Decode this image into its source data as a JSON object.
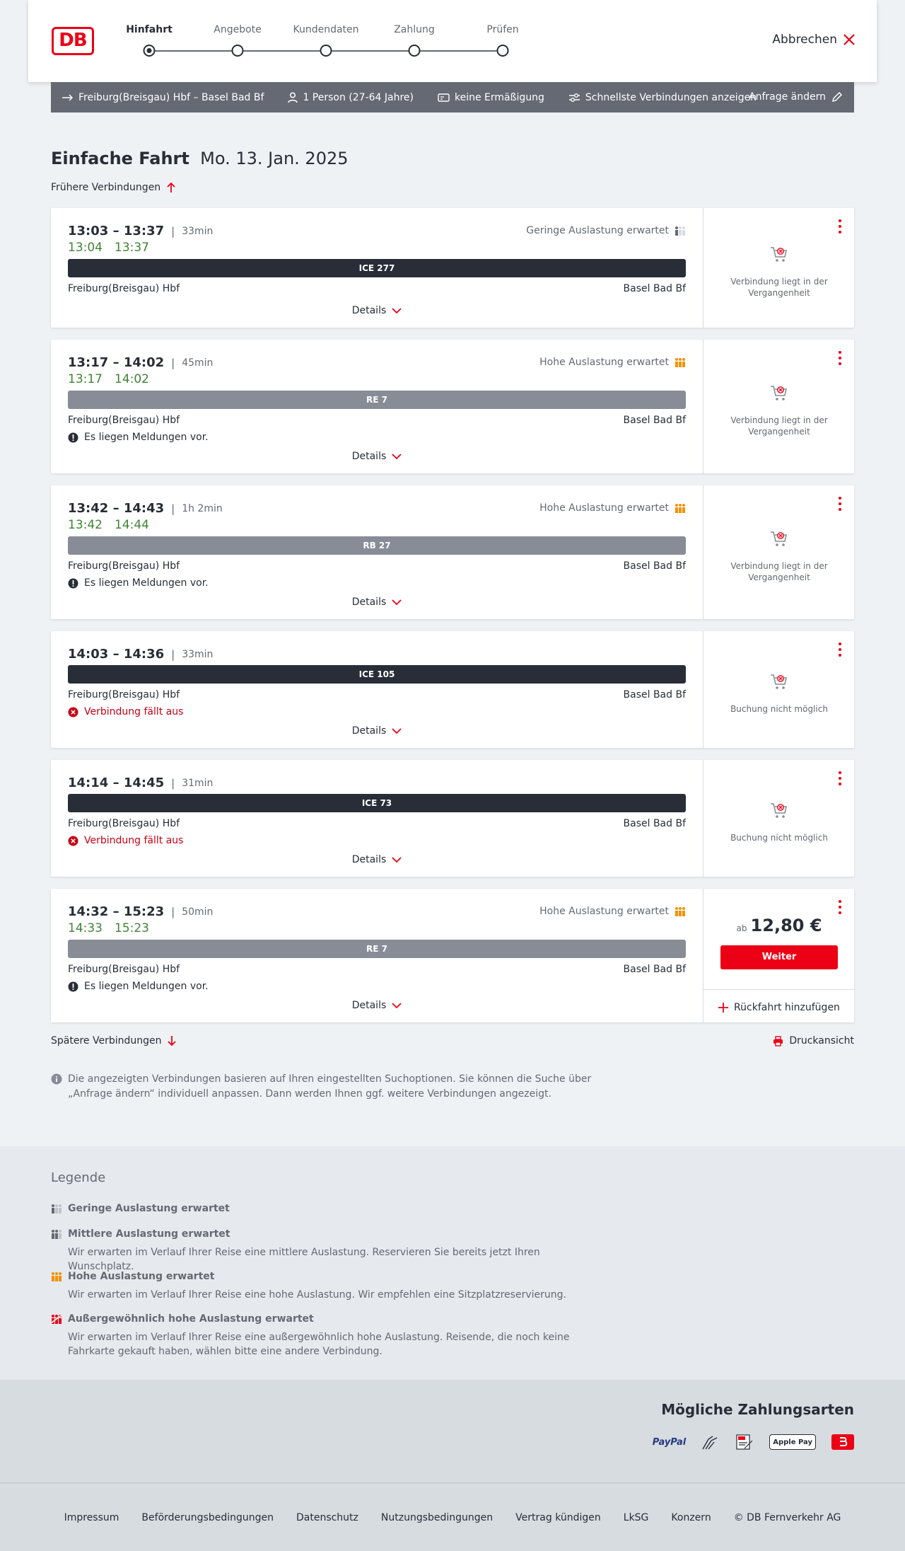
{
  "header": {
    "logo": "DB",
    "steps": [
      "Hinfahrt",
      "Angebote",
      "Kundendaten",
      "Zahlung",
      "Prüfen"
    ],
    "cancel_label": "Abbrechen"
  },
  "query": {
    "route": "Freiburg(Breisgau) Hbf – Basel Bad Bf",
    "persons": "1 Person (27-64 Jahre)",
    "discount": "keine Ermäßigung",
    "fastest": "Schnellste Verbindungen anzeigen",
    "change_label": "Anfrage ändern"
  },
  "title": {
    "trip_type": "Einfache Fahrt",
    "date": "Mo. 13. Jan. 2025"
  },
  "earlier_label": "Frühere Verbindungen",
  "later_label": "Spätere Verbindungen",
  "print_label": "Druckansicht",
  "details_label": "Details",
  "connections": [
    {
      "times": "13:03 – 13:37",
      "duration": "33min",
      "rt_dep": "13:04",
      "rt_arr": "13:37",
      "occupancy": "Geringe Auslastung erwartet",
      "train": "ICE 277",
      "from": "Freiburg(Breisgau) Hbf",
      "to": "Basel Bad Bf",
      "status": "Verbindung liegt in der Vergangenheit"
    },
    {
      "times": "13:17 – 14:02",
      "duration": "45min",
      "rt_dep": "13:17",
      "rt_arr": "14:02",
      "occupancy": "Hohe Auslastung erwartet",
      "train": "RE 7",
      "from": "Freiburg(Breisgau) Hbf",
      "to": "Basel Bad Bf",
      "message": "Es liegen Meldungen vor.",
      "status": "Verbindung liegt in der Vergangenheit"
    },
    {
      "times": "13:42 – 14:43",
      "duration": "1h 2min",
      "rt_dep": "13:42",
      "rt_arr": "14:44",
      "occupancy": "Hohe Auslastung erwartet",
      "train": "RB 27",
      "from": "Freiburg(Breisgau) Hbf",
      "to": "Basel Bad Bf",
      "message": "Es liegen Meldungen vor.",
      "status": "Verbindung liegt in der Vergangenheit"
    },
    {
      "times": "14:03 – 14:36",
      "duration": "33min",
      "train": "ICE 105",
      "from": "Freiburg(Breisgau) Hbf",
      "to": "Basel Bad Bf",
      "message": "Verbindung fällt aus",
      "status": "Buchung nicht möglich"
    },
    {
      "times": "14:14 – 14:45",
      "duration": "31min",
      "train": "ICE 73",
      "from": "Freiburg(Breisgau) Hbf",
      "to": "Basel Bad Bf",
      "message": "Verbindung fällt aus",
      "status": "Buchung nicht möglich"
    },
    {
      "times": "14:32 – 15:23",
      "duration": "50min",
      "rt_dep": "14:33",
      "rt_arr": "15:23",
      "occupancy": "Hohe Auslastung erwartet",
      "train": "RE 7",
      "from": "Freiburg(Breisgau) Hbf",
      "to": "Basel Bad Bf",
      "message": "Es liegen Meldungen vor.",
      "price_prefix": "ab",
      "price": "12,80 €",
      "button": "Weiter",
      "return_label": "Rückfahrt hinzufügen"
    }
  ],
  "info_text": "Die angezeigten Verbindungen basieren auf Ihren eingestellten Suchoptionen. Sie können die Suche über „Anfrage ändern“ individuell anpassen. Dann werden Ihnen ggf. weitere Verbindungen angezeigt.",
  "legend": {
    "title": "Legende",
    "items": [
      {
        "title": "Geringe Auslastung erwartet",
        "desc": ""
      },
      {
        "title": "Mittlere Auslastung erwartet",
        "desc": "Wir erwarten im Verlauf Ihrer Reise eine mittlere Auslastung. Reservieren Sie bereits jetzt Ihren Wunschplatz."
      },
      {
        "title": "Hohe Auslastung erwartet",
        "desc": "Wir erwarten im Verlauf Ihrer Reise eine hohe Auslastung. Wir empfehlen eine Sitzplatzreservierung."
      },
      {
        "title": "Außergewöhnlich hohe Auslastung erwartet",
        "desc": "Wir erwarten im Verlauf Ihrer Reise eine außergewöhnlich hohe Auslastung. Reisende, die noch keine Fahrkarte gekauft haben, wählen bitte eine andere Verbindung."
      }
    ]
  },
  "payment": {
    "title": "Mögliche Zahlungsarten",
    "methods": [
      "PayPal",
      "Apple Pay"
    ]
  },
  "footer": [
    "Impressum",
    "Beförderungsbedingungen",
    "Datenschutz",
    "Nutzungsbedingungen",
    "Vertrag kündigen",
    "LkSG",
    "Konzern",
    "© DB Fernverkehr AG"
  ],
  "colors": {
    "brand": "#ec0016",
    "realtime": "#408335",
    "occupancy_high": "#f39200",
    "query_bar": "#646973"
  }
}
